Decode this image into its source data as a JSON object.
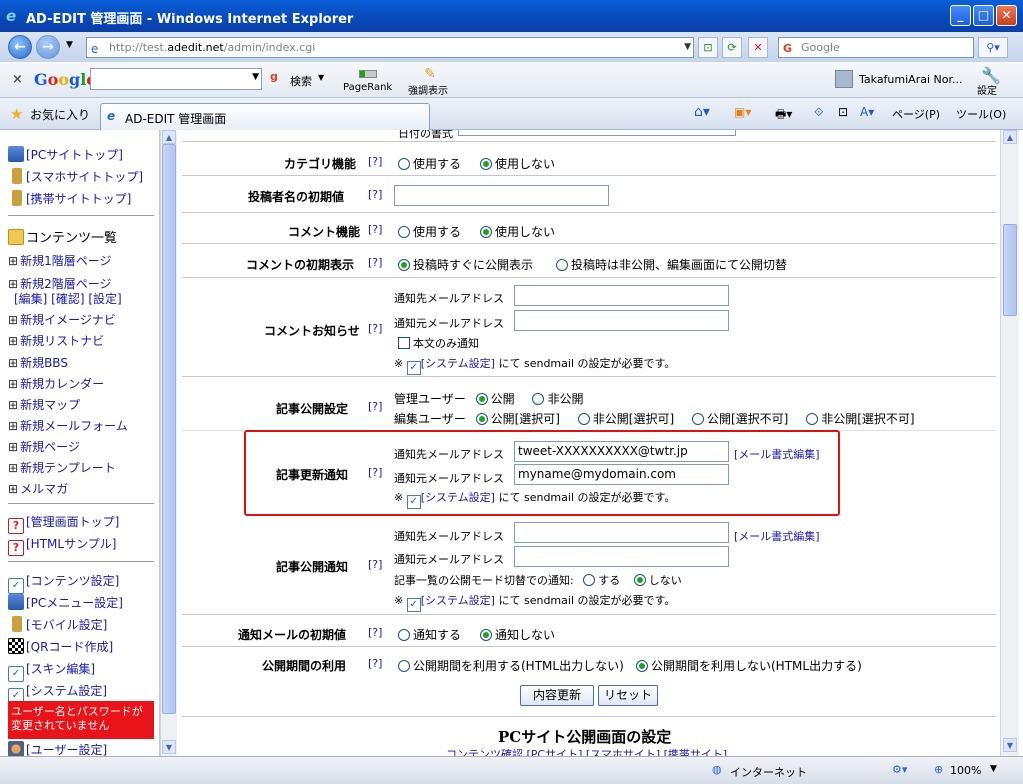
{
  "window": {
    "title": "AD-EDIT 管理画面 - Windows Internet Explorer"
  },
  "addressbar": {
    "url_prefix": "http://test.",
    "url_domain": "adedit.net",
    "url_suffix": "/admin/index.cgi",
    "search_placeholder": "Google"
  },
  "google_toolbar": {
    "logo": "Google",
    "search_label": "検索",
    "pagerank_label": "PageRank",
    "highlight_label": "強調表示",
    "user_label": "TakafumiArai Nor...",
    "settings_label": "設定"
  },
  "favorites": {
    "favorites_label": "お気に入り",
    "tab_label": "AD-EDIT 管理画面",
    "page_menu": "ページ(P)",
    "tools_menu": "ツール(O)"
  },
  "sidebar": {
    "top_links": [
      "[PCサイトトップ]",
      "[スマホサイトトップ]",
      "[携帯サイトトップ]"
    ],
    "content_list_title": "コンテンツ一覧",
    "items": [
      "新規1階層ページ",
      "新規2階層ページ",
      "[編集] [確認] [設定]",
      "新規イメージナビ",
      "新規リストナビ",
      "新規BBS",
      "新規カレンダー",
      "新規マップ",
      "新規メールフォーム",
      "新規ページ",
      "新規テンプレート",
      "メルマガ"
    ],
    "admin_links": [
      "[管理画面トップ]",
      "[HTMLサンプル]"
    ],
    "settings_links": [
      "[コンテンツ設定]",
      "[PCメニュー設定]",
      "[モバイル設定]",
      "[QRコード作成]",
      "[スキン編集]",
      "[システム設定]"
    ],
    "warning": "ユーザー名とパスワードが変更されていません",
    "user_settings": "[ユーザー設定]"
  },
  "form": {
    "help": "[?]",
    "top_partial": "日付の書式",
    "category": {
      "label": "カテゴリ機能",
      "opt_on": "使用する",
      "opt_off": "使用しない"
    },
    "poster_default": {
      "label": "投稿者名の初期値",
      "value": ""
    },
    "comment": {
      "label": "コメント機能",
      "opt_on": "使用する",
      "opt_off": "使用しない"
    },
    "comment_default": {
      "label": "コメントの初期表示",
      "opt_public": "投稿時すぐに公開表示",
      "opt_private": "投稿時は非公開、編集画面にて公開切替"
    },
    "comment_notify": {
      "label": "コメントお知らせ",
      "to_label": "通知先メールアドレス",
      "from_label": "通知元メールアドレス",
      "to_value": "",
      "from_value": "",
      "body_only": "本文のみ通知",
      "note_prefix": "※",
      "note_link": "[システム設定]",
      "note_suffix": "にて sendmail の設定が必要です。"
    },
    "publish_setting": {
      "label": "記事公開設定",
      "admin_label": "管理ユーザー",
      "admin_public": "公開",
      "admin_private": "非公開",
      "editor_label": "編集ユーザー",
      "editor_opts": [
        "公開[選択可]",
        "非公開[選択可]",
        "公開[選択不可]",
        "非公開[選択不可]"
      ]
    },
    "update_notify": {
      "label": "記事更新通知",
      "to_label": "通知先メールアドレス",
      "from_label": "通知元メールアドレス",
      "to_value": "tweet-XXXXXXXXXX@twtr.jp",
      "from_value": "myname@mydomain.com",
      "format_link": "[メール書式編集]",
      "note_prefix": "※",
      "note_link": "[システム設定]",
      "note_suffix": "にて sendmail の設定が必要です。"
    },
    "publish_notify": {
      "label": "記事公開通知",
      "to_label": "通知先メールアドレス",
      "from_label": "通知元メールアドレス",
      "to_value": "",
      "from_value": "",
      "format_link": "[メール書式編集]",
      "mode_label": "記事一覧の公開モード切替での通知:",
      "mode_yes": "する",
      "mode_no": "しない",
      "note_prefix": "※",
      "note_link": "[システム設定]",
      "note_suffix": "にて sendmail の設定が必要です。"
    },
    "notify_default": {
      "label": "通知メールの初期値",
      "opt_on": "通知する",
      "opt_off": "通知しない"
    },
    "period": {
      "label": "公開期間の利用",
      "opt_use": "公開期間を利用する(HTML出力しない)",
      "opt_nouse": "公開期間を利用しない(HTML出力する)"
    },
    "submit": "内容更新",
    "reset": "リセット",
    "next_section_title": "PCサイト公開画面の設定",
    "next_section_partial": "コンテンツ確認 [PCサイト] [スマホサイト] [携帯サイト]"
  },
  "statusbar": {
    "zone": "インターネット",
    "zoom": "100%"
  }
}
